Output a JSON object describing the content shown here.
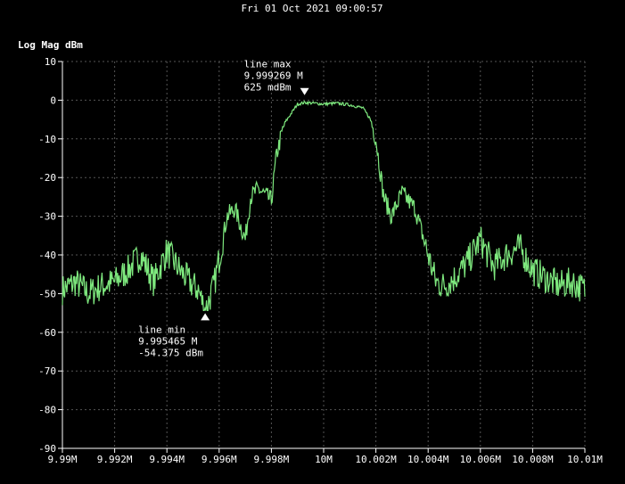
{
  "chart_data": {
    "type": "line",
    "title": "Fri 01 Oct 2021 09:00:57",
    "ylabel": "Log Mag dBm",
    "xlabel": "",
    "xlim": [
      9.99,
      10.01
    ],
    "ylim": [
      -90,
      10
    ],
    "grid": true,
    "x_tick_values": [
      9.99,
      9.992,
      9.994,
      9.996,
      9.998,
      10.0,
      10.002,
      10.004,
      10.006,
      10.008,
      10.01
    ],
    "x_tick_labels": [
      "9.99M",
      "9.992M",
      "9.994M",
      "9.996M",
      "9.998M",
      "10M",
      "10.002M",
      "10.004M",
      "10.006M",
      "10.008M",
      "10.01M"
    ],
    "y_tick_values": [
      10,
      0,
      -10,
      -20,
      -30,
      -40,
      -50,
      -60,
      -70,
      -80,
      -90
    ],
    "y_tick_labels": [
      "10",
      "0",
      "-10",
      "-20",
      "-30",
      "-40",
      "-50",
      "-60",
      "-70",
      "-80",
      "-90"
    ],
    "colors": {
      "trace": "#7ee87e",
      "grid": "#555555",
      "marker": "#ffffff"
    },
    "series": [
      {
        "x": [
          9.99,
          9.9905,
          9.991,
          9.9915,
          9.992,
          9.9925,
          9.993,
          9.9935,
          9.994,
          9.9945,
          9.995,
          9.9952,
          9.99547,
          9.9958,
          9.996,
          9.9963,
          9.9966,
          9.997,
          9.9972,
          9.9975,
          9.998,
          9.9982,
          9.9985,
          9.999,
          9.9993,
          10.0,
          10.0005,
          10.001,
          10.0015,
          10.0018,
          10.002,
          10.0023,
          10.0026,
          10.003,
          10.0035,
          10.004,
          10.0043,
          10.0046,
          10.005,
          10.0055,
          10.006,
          10.0065,
          10.007,
          10.0075,
          10.008,
          10.0085,
          10.009,
          10.0095,
          10.01
        ],
        "y": [
          -49,
          -47,
          -50,
          -48,
          -47,
          -44,
          -40,
          -47,
          -39,
          -44,
          -48,
          -49,
          -54.375,
          -48,
          -41,
          -30,
          -28,
          -36,
          -25,
          -23,
          -26,
          -14,
          -6,
          -1,
          -0.6,
          -1,
          -0.8,
          -1.2,
          -2,
          -5,
          -10,
          -25,
          -30,
          -24,
          -28,
          -40,
          -47,
          -48,
          -46,
          -42,
          -36,
          -43,
          -40,
          -38,
          -44,
          -46,
          -48,
          -47,
          -49
        ]
      }
    ],
    "annotations": [
      {
        "name": "line max",
        "x": 9.999269,
        "y": 0.625,
        "freq_text": "9.999269 M",
        "level_text": "625 mdBm",
        "label": "line max"
      },
      {
        "name": "line min",
        "x": 9.995465,
        "y": -54.375,
        "freq_text": "9.995465 M",
        "level_text": "-54.375 dBm",
        "label": "line min"
      }
    ]
  }
}
